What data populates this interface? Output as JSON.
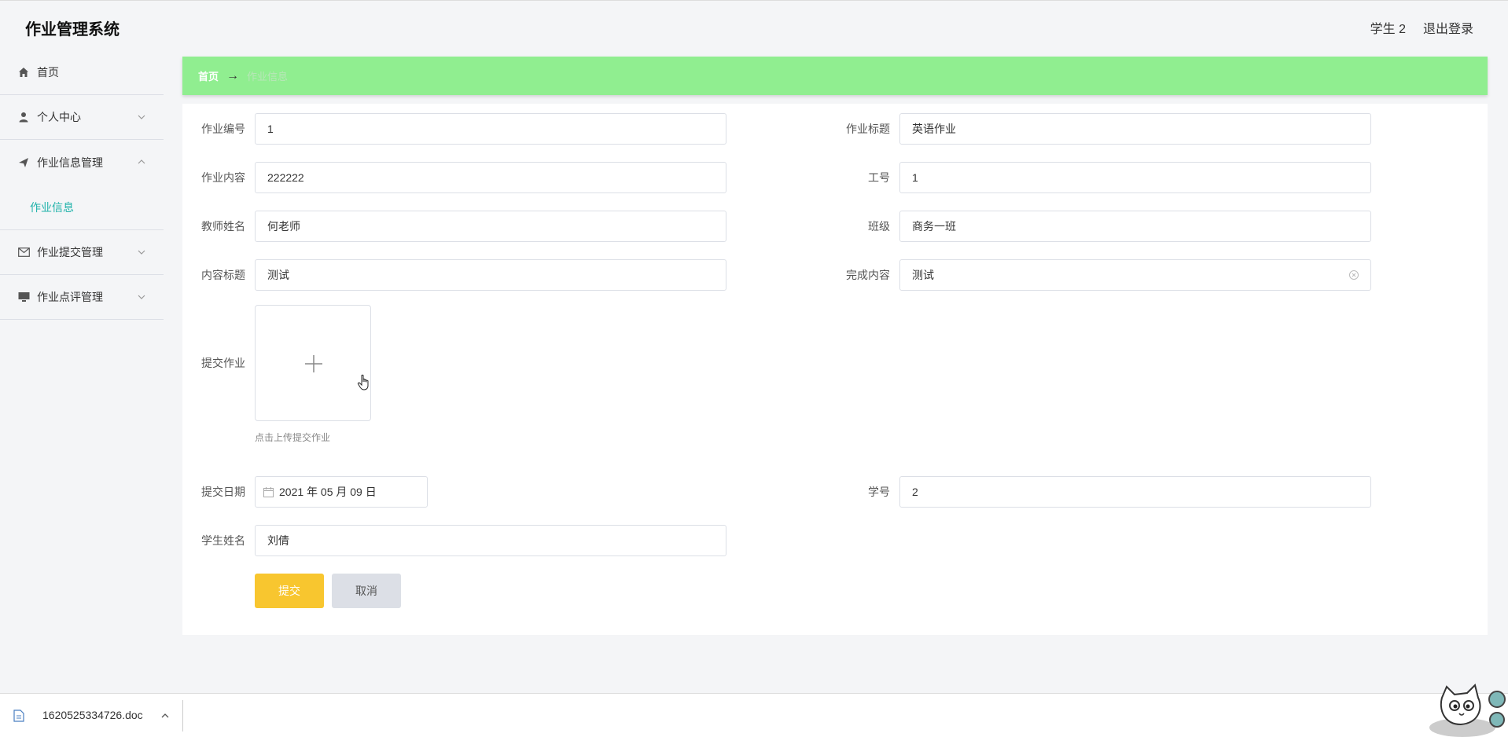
{
  "header": {
    "app_title": "作业管理系统",
    "user_label": "学生 2",
    "logout_label": "退出登录"
  },
  "sidebar": {
    "items": [
      {
        "label": "首页",
        "icon": "home-icon"
      },
      {
        "label": "个人中心",
        "icon": "user-icon"
      },
      {
        "label": "作业信息管理",
        "icon": "send-icon",
        "expanded": true
      },
      {
        "label": "作业提交管理",
        "icon": "mail-icon"
      },
      {
        "label": "作业点评管理",
        "icon": "monitor-icon"
      }
    ],
    "sub_item": "作业信息"
  },
  "breadcrumb": {
    "home": "首页",
    "separator": "→",
    "current": "作业信息"
  },
  "form": {
    "homework_no": {
      "label": "作业编号",
      "value": "1"
    },
    "homework_title": {
      "label": "作业标题",
      "value": "英语作业"
    },
    "homework_content": {
      "label": "作业内容",
      "value": "222222"
    },
    "staff_no": {
      "label": "工号",
      "value": "1"
    },
    "teacher_name": {
      "label": "教师姓名",
      "value": "何老师"
    },
    "class_name": {
      "label": "班级",
      "value": "商务一班"
    },
    "content_title": {
      "label": "内容标题",
      "value": "测试"
    },
    "completed_content": {
      "label": "完成内容",
      "value": "测试"
    },
    "submit_homework": {
      "label": "提交作业",
      "tip": "点击上传提交作业"
    },
    "submit_date": {
      "label": "提交日期",
      "value": "2021 年 05 月 09 日"
    },
    "student_no": {
      "label": "学号",
      "value": "2"
    },
    "student_name": {
      "label": "学生姓名",
      "value": "刘倩"
    },
    "submit_button": "提交",
    "cancel_button": "取消"
  },
  "download_bar": {
    "file_name": "1620525334726.doc"
  },
  "colors": {
    "breadcrumb_bg": "#90ee90",
    "submit_bg": "#f8c62f",
    "active_sub": "#20b2aa"
  }
}
